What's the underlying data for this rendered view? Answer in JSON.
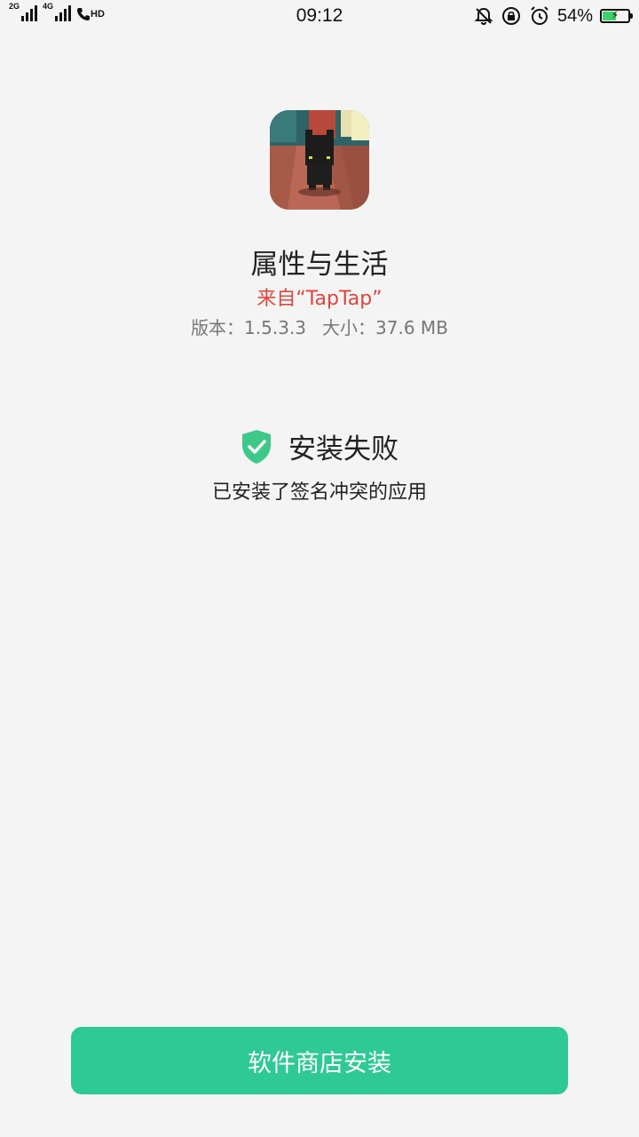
{
  "status_bar": {
    "net1": "2G",
    "net2": "4G",
    "hd": "HD",
    "time": "09:12",
    "battery_pct": "54%",
    "battery_level": 0.54,
    "icons": [
      "mute-icon",
      "rotation-lock-icon",
      "alarm-icon",
      "battery-charging-icon"
    ]
  },
  "app": {
    "name": "属性与生活",
    "source": "来自“TapTap”",
    "version": "版本：1.5.3.3",
    "size": "大小：37.6 MB",
    "icon": "app-icon-pixel-cat"
  },
  "result": {
    "icon": "shield-check-icon",
    "title": "安装失败",
    "message": "已安装了签名冲突的应用"
  },
  "actions": {
    "store_install_label": "软件商店安装"
  },
  "colors": {
    "accent": "#2ec994",
    "source_red": "#e0453e",
    "background": "#f4f4f4",
    "shield_green": "#3ec98a"
  }
}
